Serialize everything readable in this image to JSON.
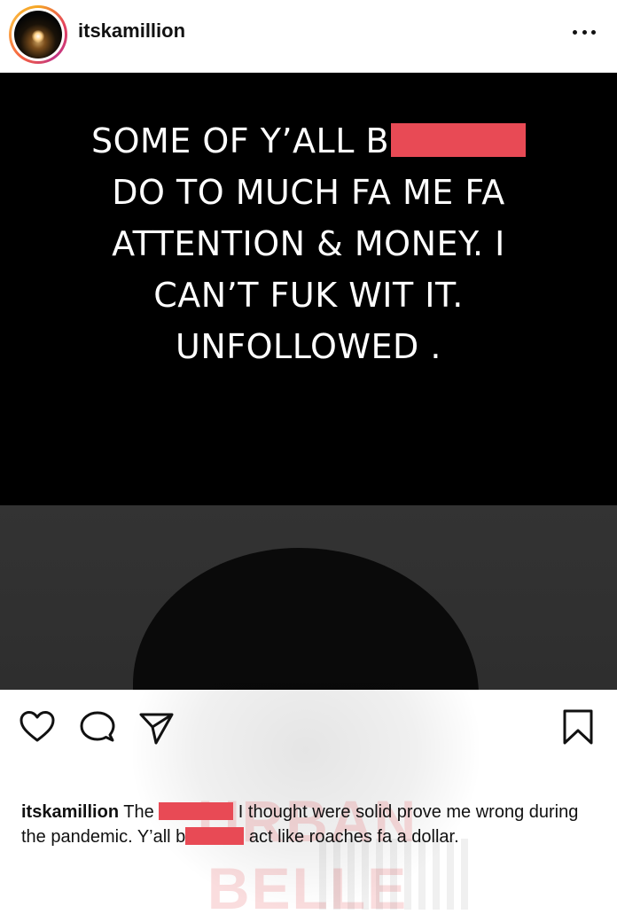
{
  "header": {
    "username": "itskamillion",
    "avatar_icon": "profile-avatar",
    "more_icon": "more-options-icon"
  },
  "post": {
    "lines": [
      "SOME OF Y’ALL B",
      "DO TO MUCH FA ME FA",
      "ATTENTION & MONEY. I",
      "CAN’T FUK WIT IT.",
      "UNFOLLOWED ."
    ],
    "redaction_color": "#e84a55",
    "background": "#000000",
    "text_color": "#ffffff"
  },
  "watermark": {
    "text": "URBAN BELLE"
  },
  "actions": {
    "icons": [
      "heart-icon",
      "comment-icon",
      "share-icon",
      "bookmark-icon"
    ]
  },
  "caption": {
    "username": "itskamillion",
    "part1": " The ",
    "part2": " I thought were solid prove me wrong during the pandemic. Y’all b",
    "part3": " act like roaches fa a dollar."
  }
}
